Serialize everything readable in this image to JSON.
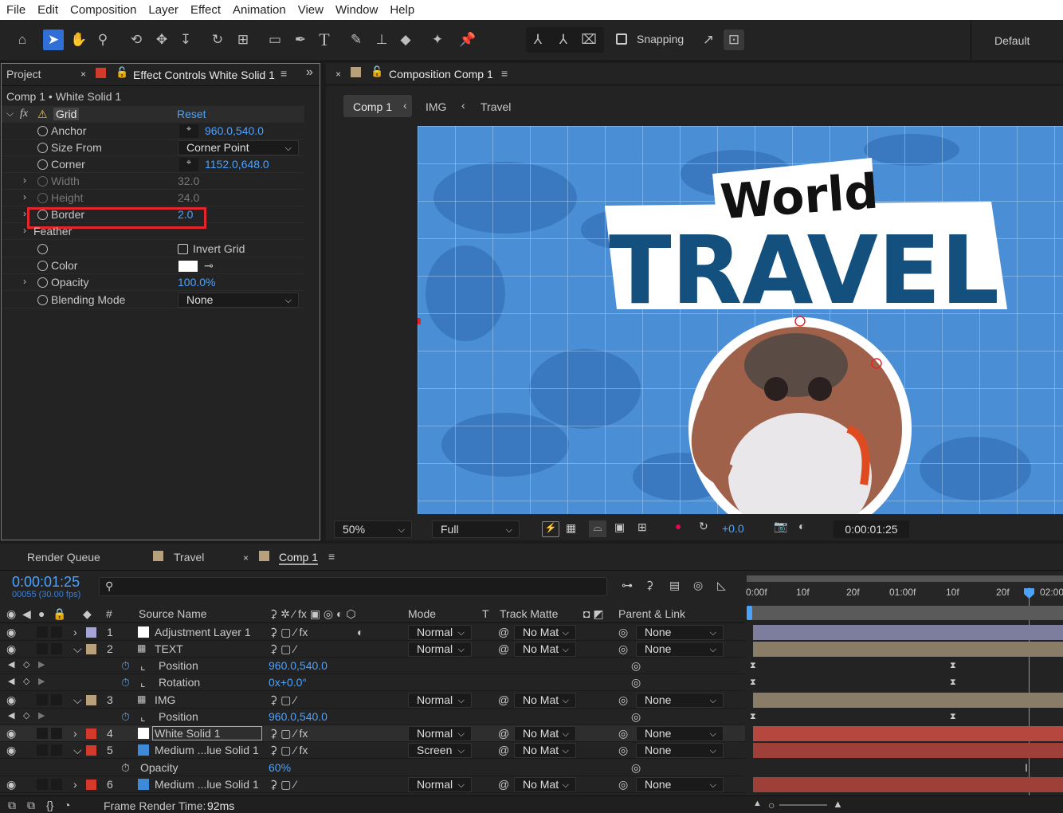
{
  "menu": [
    "File",
    "Edit",
    "Composition",
    "Layer",
    "Effect",
    "Animation",
    "View",
    "Window",
    "Help"
  ],
  "toolbar": {
    "snapping": "Snapping",
    "workspace": "Default"
  },
  "project_tab": "Project",
  "effect_tab": "Effect Controls White Solid 1",
  "ec_breadcrumb": "Comp 1 • White Solid 1",
  "effect": {
    "fx": "fx",
    "name": "Grid",
    "reset": "Reset"
  },
  "props": [
    {
      "name": "Anchor",
      "value": "960.0,540.0"
    },
    {
      "name": "Size From",
      "value": "Corner Point"
    },
    {
      "name": "Corner",
      "value": "1152.0,648.0"
    },
    {
      "name": "Width",
      "value": "32.0"
    },
    {
      "name": "Height",
      "value": "24.0"
    },
    {
      "name": "Border",
      "value": "2.0"
    },
    {
      "name": "Feather",
      "value": ""
    },
    {
      "name": "",
      "value": "Invert Grid"
    },
    {
      "name": "Color",
      "value": ""
    },
    {
      "name": "Opacity",
      "value": "100.0%"
    },
    {
      "name": "Blending Mode",
      "value": "None"
    }
  ],
  "comp_tab": "Composition Comp 1",
  "comp_crumbs": [
    "Comp 1",
    "IMG",
    "Travel"
  ],
  "art": {
    "world": "World",
    "travel": "TRAVEL"
  },
  "viewer_bar": {
    "zoom": "50%",
    "res": "Full",
    "exposure": "+0.0",
    "timecode": "0:00:01:25"
  },
  "tl_tabs": [
    "Render Queue",
    "Travel",
    "Comp 1"
  ],
  "tl": {
    "time": "0:00:01:25",
    "frames": "00055 (30.00 fps)",
    "search": ""
  },
  "ruler": [
    "0:00f",
    "10f",
    "20f",
    "01:00f",
    "10f",
    "20f",
    "02:00"
  ],
  "cols": {
    "num": "#",
    "source": "Source Name",
    "mode": "Mode",
    "t": "T",
    "matte": "Track Matte",
    "parent": "Parent & Link"
  },
  "layers": [
    {
      "num": "1",
      "name": "Adjustment Layer 1",
      "mode": "Normal",
      "matte": "No Mat",
      "parent": "None"
    },
    {
      "num": "2",
      "name": "TEXT",
      "mode": "Normal",
      "matte": "No Mat",
      "parent": "None"
    },
    {
      "sub": "Position",
      "val": "960.0,540.0"
    },
    {
      "sub": "Rotation",
      "val": "0x+0.0°"
    },
    {
      "num": "3",
      "name": "IMG",
      "mode": "Normal",
      "matte": "No Mat",
      "parent": "None"
    },
    {
      "sub": "Position",
      "val": "960.0,540.0"
    },
    {
      "num": "4",
      "name": "White Solid 1",
      "mode": "Normal",
      "matte": "No Mat",
      "parent": "None"
    },
    {
      "num": "5",
      "name": "Medium ...lue Solid 1",
      "mode": "Screen",
      "matte": "No Mat",
      "parent": "None"
    },
    {
      "sub": "Opacity",
      "val": "60%"
    },
    {
      "num": "6",
      "name": "Medium ...lue Solid 1",
      "mode": "Normal",
      "matte": "No Mat",
      "parent": "None"
    }
  ],
  "status": {
    "label": "Frame Render Time:",
    "value": "92ms"
  },
  "colors": {
    "accent": "#2d8cf0",
    "highlight": "#e3262c",
    "viewer_bg": "#4a8fd6",
    "travel": "#14507e"
  }
}
